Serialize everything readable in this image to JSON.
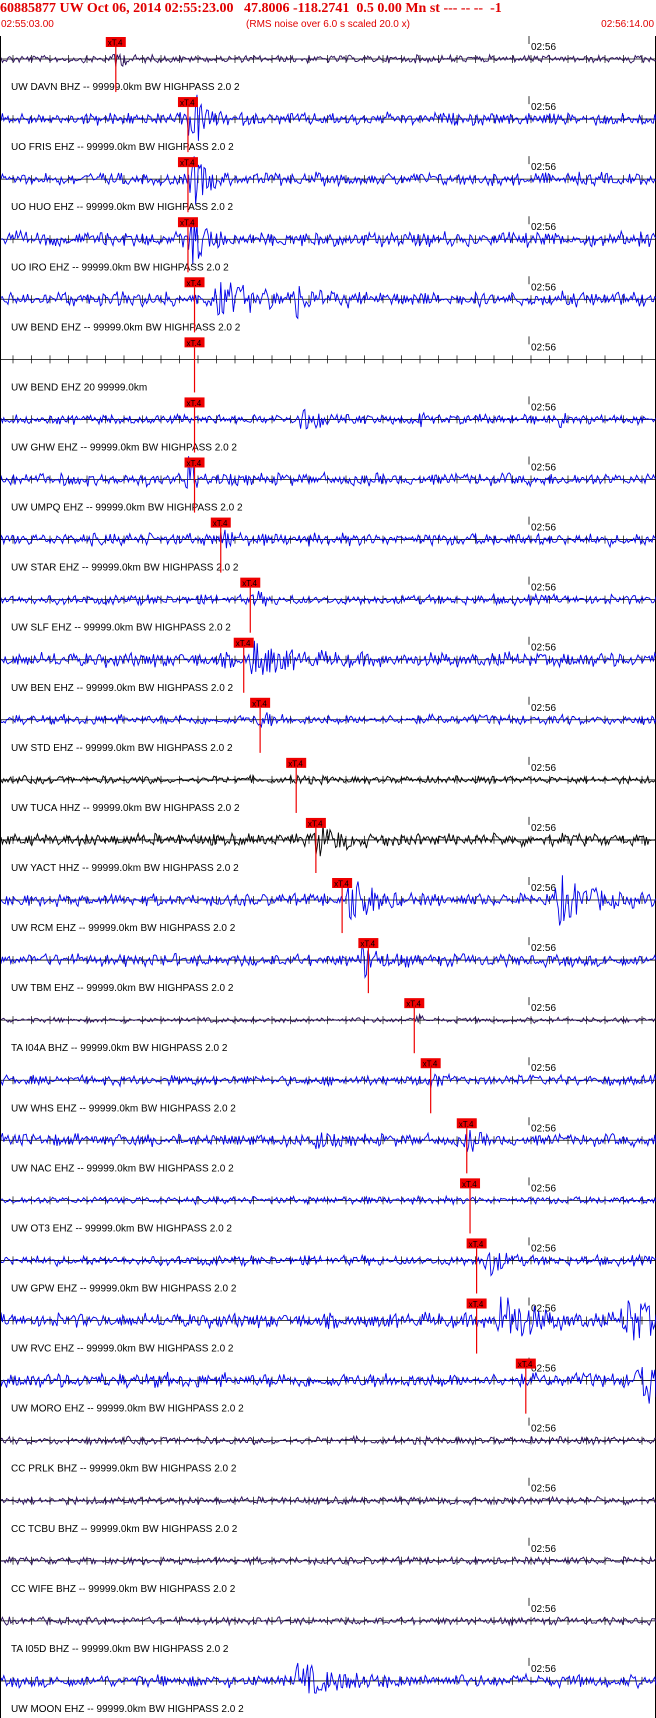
{
  "header": {
    "title": "60885877 UW Oct 06, 2014 02:55:23.00   47.8006 -118.2741  0.5 0.00 Mn st --- -- --  -1",
    "start_time": "02:55:03.00",
    "end_time": "02:56:14.00",
    "noise_note": "(RMS noise over 6.0 s scaled 20.0 x)"
  },
  "time_tick_label": "02:56",
  "pick_label": "xT.4",
  "colors": {
    "header_text": "#e00000",
    "pick": "#ee0000",
    "trace_blue": "#0000e6",
    "trace_black": "#000000",
    "trace_purple": "#2a0f5c"
  },
  "traces": [
    {
      "label": "UW DAVN BHZ -- 99999.0km BW  HIGHPASS  2.0  2",
      "color": "purple",
      "amp": 3,
      "pick": 0.175,
      "burst": [
        {
          "t": 0.175,
          "a": 14,
          "d": 0.01
        }
      ]
    },
    {
      "label": "UO FRIS EHZ -- 99999.0km BW  HIGHPASS  2.0  2",
      "color": "blue",
      "amp": 5,
      "pick": 0.285,
      "burst": [
        {
          "t": 0.29,
          "a": 40,
          "d": 0.015
        }
      ]
    },
    {
      "label": "UO HUO EHZ -- 99999.0km BW  HIGHPASS  2.0  2",
      "color": "blue",
      "amp": 5,
      "pick": 0.285,
      "burst": [
        {
          "t": 0.29,
          "a": 40,
          "d": 0.015
        }
      ]
    },
    {
      "label": "UO IRO EHZ -- 99999.0km BW  HIGHPASS  2.0  2",
      "color": "blue",
      "amp": 6,
      "pick": 0.285,
      "burst": [
        {
          "t": 0.29,
          "a": 38,
          "d": 0.015
        }
      ]
    },
    {
      "label": "UW BEND EHZ -- 99999.0km BW  HIGHPASS  2.0  2",
      "color": "blue",
      "amp": 6,
      "pick": 0.295,
      "burst": [
        {
          "t": 0.33,
          "a": 14,
          "d": 0.06
        },
        {
          "t": 0.45,
          "a": 14,
          "d": 0.01
        }
      ]
    },
    {
      "label": "UW BEND EHZ 20 99999.0km",
      "color": "blue",
      "amp": 0,
      "pick": 0.295,
      "burst": []
    },
    {
      "label": "UW GHW EHZ -- 99999.0km BW  HIGHPASS  2.0  2",
      "color": "blue",
      "amp": 4,
      "pick": 0.295,
      "burst": [
        {
          "t": 0.46,
          "a": 22,
          "d": 0.005
        },
        {
          "t": 0.48,
          "a": 14,
          "d": 0.005
        },
        {
          "t": 0.64,
          "a": 16,
          "d": 0.004
        },
        {
          "t": 0.85,
          "a": 14,
          "d": 0.004
        }
      ]
    },
    {
      "label": "UW UMPQ EHZ -- 99999.0km BW  HIGHPASS  2.0  2",
      "color": "blue",
      "amp": 5,
      "pick": 0.295,
      "burst": [
        {
          "t": 0.285,
          "a": 30,
          "d": 0.01
        }
      ]
    },
    {
      "label": "UW STAR EHZ -- 99999.0km BW  HIGHPASS  2.0  2",
      "color": "blue",
      "amp": 5,
      "pick": 0.335,
      "burst": [
        {
          "t": 0.34,
          "a": 12,
          "d": 0.01
        }
      ]
    },
    {
      "label": "UW SLF EHZ -- 99999.0km BW  HIGHPASS  2.0  2",
      "color": "blue",
      "amp": 4,
      "pick": 0.38,
      "burst": [
        {
          "t": 0.385,
          "a": 9,
          "d": 0.01
        }
      ]
    },
    {
      "label": "UW BEN EHZ -- 99999.0km BW  HIGHPASS  2.0  2",
      "color": "blue",
      "amp": 6,
      "pick": 0.37,
      "burst": [
        {
          "t": 0.38,
          "a": 18,
          "d": 0.04
        }
      ]
    },
    {
      "label": "UW STD EHZ -- 99999.0km BW  HIGHPASS  2.0  2",
      "color": "blue",
      "amp": 4,
      "pick": 0.395,
      "burst": [
        {
          "t": 0.395,
          "a": 8,
          "d": 0.015
        }
      ]
    },
    {
      "label": "UW TUCA HHZ -- 99999.0km BW  HIGHPASS  2.0  2",
      "color": "black",
      "amp": 3,
      "pick": 0.45,
      "burst": [
        {
          "t": 0.45,
          "a": 5,
          "d": 0.01
        }
      ]
    },
    {
      "label": "UW YACT HHZ -- 99999.0km BW  HIGHPASS  2.0  2",
      "color": "black",
      "amp": 5,
      "pick": 0.48,
      "burst": [
        {
          "t": 0.48,
          "a": 16,
          "d": 0.03
        }
      ]
    },
    {
      "label": "UW RCM EHZ -- 99999.0km BW  HIGHPASS  2.0  2",
      "color": "blue",
      "amp": 5,
      "pick": 0.52,
      "burst": [
        {
          "t": 0.53,
          "a": 26,
          "d": 0.03
        },
        {
          "t": 0.85,
          "a": 24,
          "d": 0.04
        }
      ]
    },
    {
      "label": "UW TBM EHZ -- 99999.0km BW  HIGHPASS  2.0  2",
      "color": "blue",
      "amp": 5,
      "pick": 0.56,
      "burst": [
        {
          "t": 0.55,
          "a": 18,
          "d": 0.02
        }
      ]
    },
    {
      "label": "TA I04A BHZ -- 99999.0km BW  HIGHPASS  2.0  2",
      "color": "purple",
      "amp": 2,
      "pick": 0.63,
      "burst": [
        {
          "t": 0.635,
          "a": 10,
          "d": 0.004
        }
      ]
    },
    {
      "label": "UW WHS EHZ -- 99999.0km BW  HIGHPASS  2.0  2",
      "color": "blue",
      "amp": 4,
      "pick": 0.655,
      "burst": [
        {
          "t": 0.655,
          "a": 10,
          "d": 0.01
        }
      ]
    },
    {
      "label": "UW NAC EHZ -- 99999.0km BW  HIGHPASS  2.0  2",
      "color": "blue",
      "amp": 5,
      "pick": 0.71,
      "burst": [
        {
          "t": 0.48,
          "a": 10,
          "d": 0.01
        },
        {
          "t": 0.71,
          "a": 12,
          "d": 0.01
        }
      ]
    },
    {
      "label": "UW OT3 EHZ -- 99999.0km BW  HIGHPASS  2.0  2",
      "color": "blue",
      "amp": 3,
      "pick": 0.715,
      "burst": []
    },
    {
      "label": "UW GPW EHZ -- 99999.0km BW  HIGHPASS  2.0  2",
      "color": "blue",
      "amp": 4,
      "pick": 0.725,
      "burst": [
        {
          "t": 0.74,
          "a": 18,
          "d": 0.02
        }
      ]
    },
    {
      "label": "UW RVC EHZ -- 99999.0km BW  HIGHPASS  2.0  2",
      "color": "blue",
      "amp": 6,
      "pick": 0.725,
      "burst": [
        {
          "t": 0.76,
          "a": 28,
          "d": 0.04
        },
        {
          "t": 0.95,
          "a": 22,
          "d": 0.05
        }
      ]
    },
    {
      "label": "UW MORO EHZ -- 99999.0km BW  HIGHPASS  2.0  2",
      "color": "blue",
      "amp": 6,
      "pick": 0.8,
      "burst": [
        {
          "t": 0.97,
          "a": 26,
          "d": 0.05
        }
      ]
    },
    {
      "label": "CC PRLK BHZ -- 99999.0km BW  HIGHPASS  2.0  2",
      "color": "purple",
      "amp": 3,
      "pick": null,
      "burst": []
    },
    {
      "label": "CC TCBU BHZ -- 99999.0km BW  HIGHPASS  2.0  2",
      "color": "purple",
      "amp": 3,
      "pick": null,
      "burst": []
    },
    {
      "label": "CC WIFE BHZ -- 99999.0km BW  HIGHPASS  2.0  2",
      "color": "purple",
      "amp": 3,
      "pick": null,
      "burst": []
    },
    {
      "label": "TA I05D BHZ -- 99999.0km BW  HIGHPASS  2.0  2",
      "color": "purple",
      "amp": 3,
      "pick": null,
      "burst": []
    },
    {
      "label": "UW MOON EHZ -- 99999.0km BW  HIGHPASS  2.0  2",
      "color": "blue",
      "amp": 5,
      "pick": null,
      "burst": [
        {
          "t": 0.45,
          "a": 14,
          "d": 0.06
        }
      ]
    }
  ]
}
